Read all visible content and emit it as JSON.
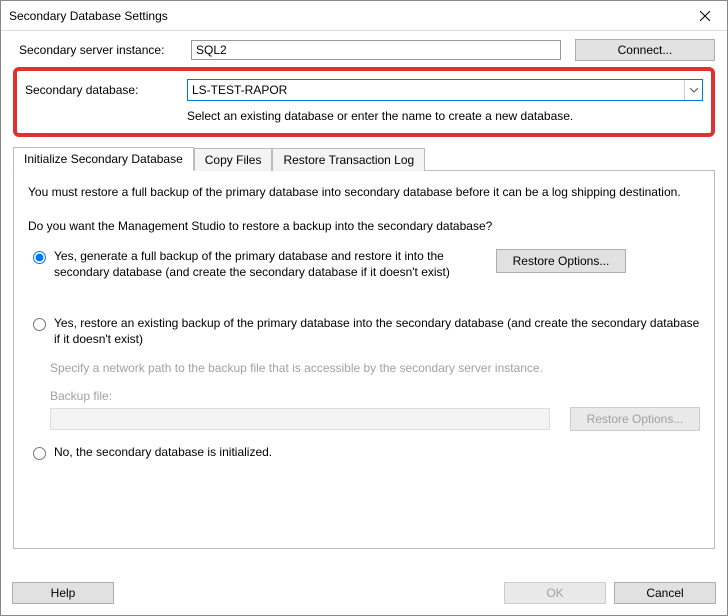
{
  "window": {
    "title": "Secondary Database Settings"
  },
  "fields": {
    "server_instance_label": "Secondary server instance:",
    "server_instance_value": "SQL2",
    "connect_label": "Connect...",
    "secondary_db_label": "Secondary database:",
    "secondary_db_value": "LS-TEST-RAPOR",
    "secondary_db_help": "Select an existing database or enter the name to create a new database."
  },
  "tabs": {
    "initialize": "Initialize Secondary Database",
    "copy": "Copy Files",
    "restore": "Restore Transaction Log"
  },
  "panel": {
    "intro": "You must restore a full backup of the primary database into secondary database before it can be a log shipping destination.",
    "question": "Do you want the Management Studio to restore a backup into the secondary database?",
    "option1": "Yes, generate a full backup of the primary database and restore it into the secondary database (and create the secondary database if it doesn't exist)",
    "restore_options": "Restore Options...",
    "option2": "Yes, restore an existing backup of the primary database into the secondary database (and create the secondary database if it doesn't exist)",
    "network_hint": "Specify a network path to the backup file that is accessible by the secondary server instance.",
    "backup_file_label": "Backup file:",
    "backup_file_value": "",
    "restore_options2": "Restore Options...",
    "option3": "No, the secondary database is initialized."
  },
  "footer": {
    "help": "Help",
    "ok": "OK",
    "cancel": "Cancel"
  }
}
